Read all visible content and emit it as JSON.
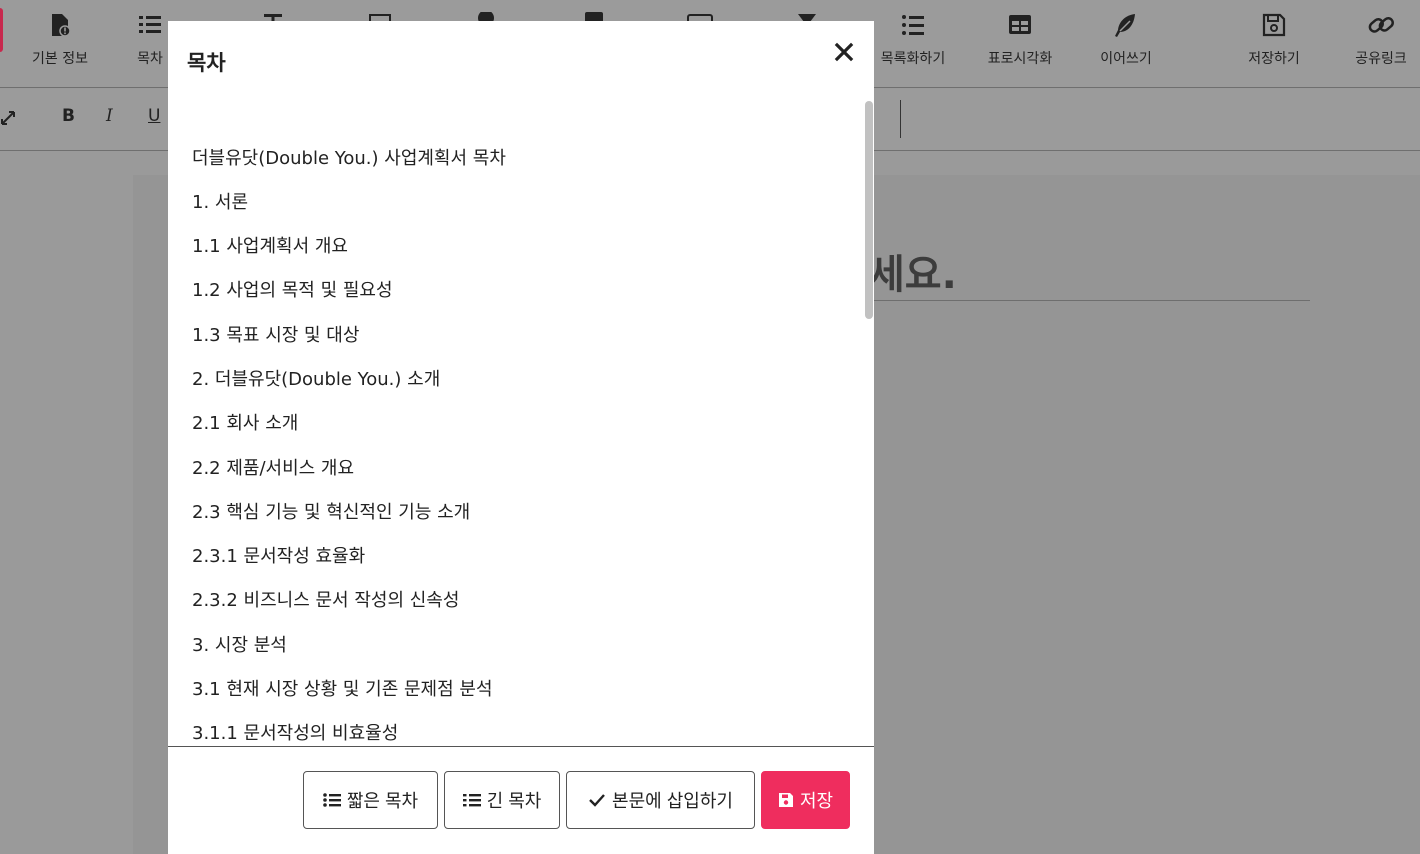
{
  "toolbar": {
    "items": [
      {
        "label": "기본 정보",
        "icon": "file-info-icon"
      },
      {
        "label": "목차",
        "icon": "ordered-list-icon"
      },
      {
        "label": "",
        "icon": "text-icon"
      },
      {
        "label": "",
        "icon": "image-icon"
      },
      {
        "label": "",
        "icon": "clock-icon"
      },
      {
        "label": "",
        "icon": "square-icon"
      },
      {
        "label": "",
        "icon": "keyboard-icon"
      },
      {
        "label": "",
        "icon": "hourglass-icon"
      },
      {
        "label": "목록화하기",
        "icon": "list-icon"
      },
      {
        "label": "표로시각화",
        "icon": "table-icon"
      },
      {
        "label": "이어쓰기",
        "icon": "feather-icon"
      },
      {
        "label": "저장하기",
        "icon": "floppy-icon"
      },
      {
        "label": "공유링크",
        "icon": "link-icon"
      }
    ]
  },
  "formatbar": {
    "bold": "B",
    "italic": "I",
    "underline": "U"
  },
  "editor": {
    "title_fragment": "세요."
  },
  "modal": {
    "title": "목차",
    "close_icon": "close-icon",
    "toc": [
      "더블유닷(Double You.) 사업계획서 목차",
      "1. 서론",
      "1.1 사업계획서 개요",
      "1.2 사업의 목적 및 필요성",
      "1.3 목표 시장 및 대상",
      "2. 더블유닷(Double You.) 소개",
      "2.1 회사 소개",
      "2.2 제품/서비스 개요",
      "2.3 핵심 기능 및 혁신적인 기능 소개",
      "2.3.1 문서작성 효율화",
      "2.3.2 비즈니스 문서 작성의 신속성",
      "3. 시장 분석",
      "3.1 현재 시장 상황 및 기존 문제점 분석",
      "3.1.1 문서작성의 비효율성"
    ],
    "buttons": {
      "short_toc": "짧은 목차",
      "long_toc": "긴 목차",
      "insert": "본문에 삽입하기",
      "save": "저장"
    }
  },
  "colors": {
    "save_button": "#ef2d5e",
    "overlay": "#9a9a9a"
  }
}
